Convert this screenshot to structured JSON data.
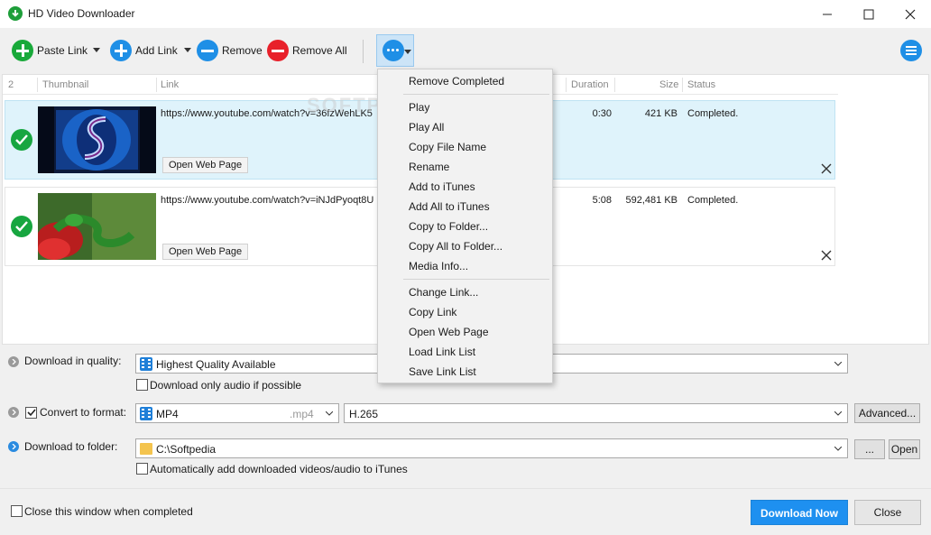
{
  "window": {
    "title": "HD Video Downloader"
  },
  "toolbar": {
    "paste_link": "Paste Link",
    "add_link": "Add Link",
    "remove": "Remove",
    "remove_all": "Remove All"
  },
  "columns": {
    "count": "2",
    "thumbnail": "Thumbnail",
    "link": "Link",
    "duration": "Duration",
    "size": "Size",
    "status": "Status"
  },
  "items": [
    {
      "link": "https://www.youtube.com/watch?v=36fzWehLK5",
      "open_web_page": "Open Web Page",
      "duration": "0:30",
      "size": "421 KB",
      "status": "Completed."
    },
    {
      "link": "https://www.youtube.com/watch?v=iNJdPyoqt8U",
      "open_web_page": "Open Web Page",
      "duration": "5:08",
      "size": "592,481 KB",
      "status": "Completed."
    }
  ],
  "watermark": "SOFTPEDIA",
  "context_menu": {
    "group1": [
      "Remove Completed"
    ],
    "group2": [
      "Play",
      "Play All",
      "Copy File Name",
      "Rename",
      "Add to iTunes",
      "Add All to iTunes",
      "Copy to Folder...",
      "Copy All to Folder...",
      "Media Info..."
    ],
    "group3": [
      "Change Link...",
      "Copy Link",
      "Open Web Page",
      "Load Link List",
      "Save Link List"
    ]
  },
  "options": {
    "quality_label": "Download in quality:",
    "quality_value": "Highest Quality Available",
    "audio_only_label": "Download only audio if possible",
    "convert_label": "Convert to format:",
    "convert_checked": true,
    "format_value": "MP4",
    "format_ext": ".mp4",
    "codec_value": "H.265",
    "advanced_button": "Advanced...",
    "folder_label": "Download to folder:",
    "folder_value": "C:\\Softpedia",
    "browse_button": "...",
    "open_button": "Open",
    "itunes_label": "Automatically add downloaded videos/audio to iTunes"
  },
  "footer": {
    "close_when_completed": "Close this window when completed",
    "download_now": "Download Now",
    "close": "Close"
  },
  "colors": {
    "accent": "#1e90f0",
    "green": "#19a93a",
    "red": "#e8202a",
    "selected_row": "#dff3fb"
  },
  "icons": [
    "download-arrow-icon",
    "plus-icon",
    "minus-icon",
    "more-dots-icon",
    "hamburger-menu-icon",
    "check-circle-icon",
    "close-x-icon",
    "film-icon",
    "folder-icon",
    "chevron-down-icon"
  ]
}
